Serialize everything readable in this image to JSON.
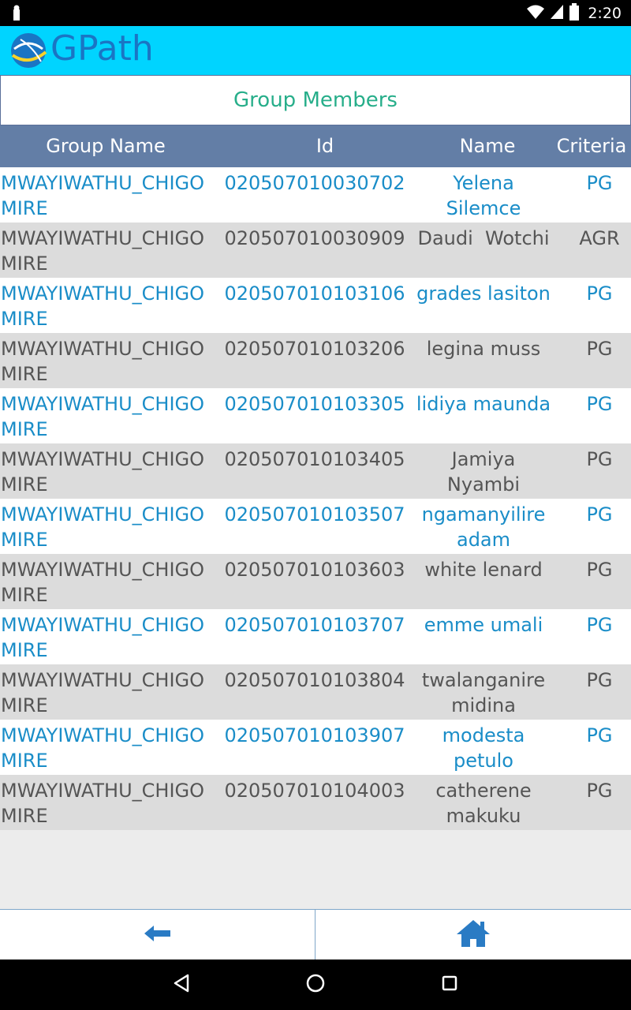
{
  "status_bar": {
    "time": "2:20",
    "icons": [
      "notification-icon",
      "wifi-icon",
      "signal-icon",
      "battery-icon"
    ]
  },
  "app": {
    "logo_text": "GPath",
    "brand_color": "#00d4ff"
  },
  "page": {
    "title": "Group Members"
  },
  "table": {
    "headers": {
      "group_name": "Group Name",
      "id": "Id",
      "name": "Name",
      "criteria": "Criteria"
    },
    "rows": [
      {
        "group": "MWAYIWATHU_CHIGOMIRE",
        "id": "020507010030702",
        "name": "Yelena Silemce",
        "criteria": "PG"
      },
      {
        "group": "MWAYIWATHU_CHIGOMIRE",
        "id": "020507010030909",
        "name": "Daudi  Wotchi",
        "criteria": "AGR"
      },
      {
        "group": "MWAYIWATHU_CHIGOMIRE",
        "id": "020507010103106",
        "name": "grades lasiton",
        "criteria": "PG"
      },
      {
        "group": "MWAYIWATHU_CHIGOMIRE",
        "id": "020507010103206",
        "name": "legina muss",
        "criteria": "PG"
      },
      {
        "group": "MWAYIWATHU_CHIGOMIRE",
        "id": "020507010103305",
        "name": "lidiya maunda",
        "criteria": "PG"
      },
      {
        "group": "MWAYIWATHU_CHIGOMIRE",
        "id": "020507010103405",
        "name": "Jamiya Nyambi",
        "criteria": "PG"
      },
      {
        "group": "MWAYIWATHU_CHIGOMIRE",
        "id": "020507010103507",
        "name": "ngamanyilire adam",
        "criteria": "PG"
      },
      {
        "group": "MWAYIWATHU_CHIGOMIRE",
        "id": "020507010103603",
        "name": "white lenard",
        "criteria": "PG"
      },
      {
        "group": "MWAYIWATHU_CHIGOMIRE",
        "id": "020507010103707",
        "name": "emme umali",
        "criteria": "PG"
      },
      {
        "group": "MWAYIWATHU_CHIGOMIRE",
        "id": "020507010103804",
        "name": "twalanganire midina",
        "criteria": "PG"
      },
      {
        "group": "MWAYIWATHU_CHIGOMIRE",
        "id": "020507010103907",
        "name": "modesta petulo",
        "criteria": "PG"
      },
      {
        "group": "MWAYIWATHU_CHIGOMIRE",
        "id": "020507010104003",
        "name": "catherene makuku",
        "criteria": "PG"
      }
    ]
  },
  "bottom_nav": {
    "back_icon": "arrow-left-icon",
    "home_icon": "home-icon",
    "icon_color": "#2a7bc4"
  },
  "system_nav": {
    "icons": [
      "back-triangle-icon",
      "home-circle-icon",
      "recents-square-icon"
    ]
  }
}
